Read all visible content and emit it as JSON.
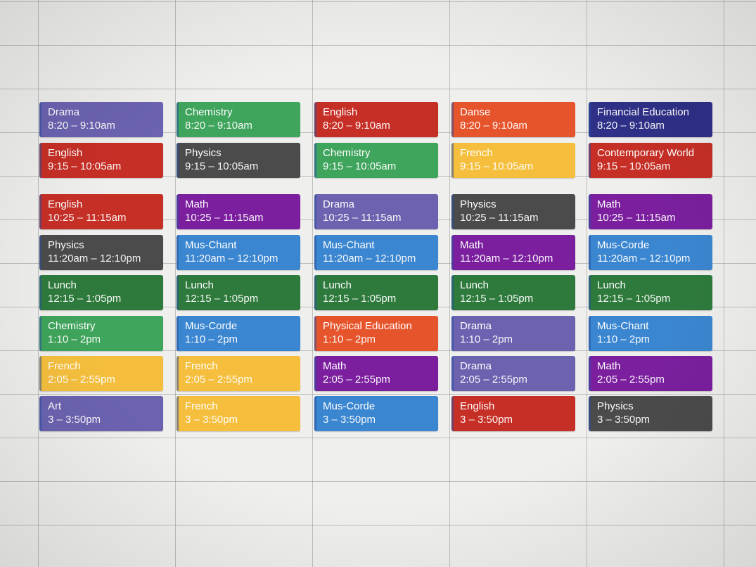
{
  "colors": {
    "lavender": "#6b63b0",
    "sage": "#3fa45c",
    "tomato": "#c62f26",
    "tangerine": "#e6542b",
    "blueberry": "#2f3088",
    "graphite": "#4c4b4b",
    "banana": "#f5bf3d",
    "grape": "#7b1f9e",
    "peacock": "#3b86d0",
    "basil": "#2e7a3c"
  },
  "days": [
    {
      "events": [
        {
          "title": "Drama",
          "time": "8:20 – 9:10am",
          "color": "#6b63b0"
        },
        {
          "title": "English",
          "time": "9:15 – 10:05am",
          "color": "#c62f26"
        },
        {
          "title": "English",
          "time": "10:25 – 11:15am",
          "color": "#c62f26"
        },
        {
          "title": "Physics",
          "time": "11:20am – 12:10pm",
          "color": "#4c4b4b"
        },
        {
          "title": "Lunch",
          "time": "12:15 – 1:05pm",
          "color": "#2e7a3c"
        },
        {
          "title": "Chemistry",
          "time": "1:10 – 2pm",
          "color": "#3fa45c"
        },
        {
          "title": "French",
          "time": "2:05 – 2:55pm",
          "color": "#f5bf3d"
        },
        {
          "title": "Art",
          "time": "3 – 3:50pm",
          "color": "#6b63b0"
        }
      ]
    },
    {
      "events": [
        {
          "title": "Chemistry",
          "time": "8:20 – 9:10am",
          "color": "#3fa45c"
        },
        {
          "title": "Physics",
          "time": "9:15 – 10:05am",
          "color": "#4c4b4b"
        },
        {
          "title": "Math",
          "time": "10:25 – 11:15am",
          "color": "#7b1f9e"
        },
        {
          "title": "Mus-Chant",
          "time": "11:20am – 12:10pm",
          "color": "#3b86d0"
        },
        {
          "title": "Lunch",
          "time": "12:15 – 1:05pm",
          "color": "#2e7a3c"
        },
        {
          "title": "Mus-Corde",
          "time": "1:10 – 2pm",
          "color": "#3b86d0"
        },
        {
          "title": "French",
          "time": "2:05 – 2:55pm",
          "color": "#f5bf3d"
        },
        {
          "title": "French",
          "time": "3 – 3:50pm",
          "color": "#f5bf3d"
        }
      ]
    },
    {
      "events": [
        {
          "title": "English",
          "time": "8:20 – 9:10am",
          "color": "#c62f26"
        },
        {
          "title": "Chemistry",
          "time": "9:15 – 10:05am",
          "color": "#3fa45c"
        },
        {
          "title": "Drama",
          "time": "10:25 – 11:15am",
          "color": "#6b63b0"
        },
        {
          "title": "Mus-Chant",
          "time": "11:20am – 12:10pm",
          "color": "#3b86d0"
        },
        {
          "title": "Lunch",
          "time": "12:15 – 1:05pm",
          "color": "#2e7a3c"
        },
        {
          "title": "Physical Education",
          "time": "1:10 – 2pm",
          "color": "#e6542b"
        },
        {
          "title": "Math",
          "time": "2:05 – 2:55pm",
          "color": "#7b1f9e"
        },
        {
          "title": "Mus-Corde",
          "time": "3 – 3:50pm",
          "color": "#3b86d0"
        }
      ]
    },
    {
      "events": [
        {
          "title": "Danse",
          "time": "8:20 – 9:10am",
          "color": "#e6542b"
        },
        {
          "title": "French",
          "time": "9:15 – 10:05am",
          "color": "#f5bf3d"
        },
        {
          "title": "Physics",
          "time": "10:25 – 11:15am",
          "color": "#4c4b4b"
        },
        {
          "title": "Math",
          "time": "11:20am – 12:10pm",
          "color": "#7b1f9e"
        },
        {
          "title": "Lunch",
          "time": "12:15 – 1:05pm",
          "color": "#2e7a3c"
        },
        {
          "title": "Drama",
          "time": "1:10 – 2pm",
          "color": "#6b63b0"
        },
        {
          "title": "Drama",
          "time": "2:05 – 2:55pm",
          "color": "#6b63b0"
        },
        {
          "title": "English",
          "time": "3 – 3:50pm",
          "color": "#c62f26"
        }
      ]
    },
    {
      "events": [
        {
          "title": "Financial Education",
          "time": "8:20 – 9:10am",
          "color": "#2f3088"
        },
        {
          "title": "Contemporary World",
          "time": "9:15 – 10:05am",
          "color": "#c62f26"
        },
        {
          "title": "Math",
          "time": "10:25 – 11:15am",
          "color": "#7b1f9e"
        },
        {
          "title": "Mus-Corde",
          "time": "11:20am – 12:10pm",
          "color": "#3b86d0"
        },
        {
          "title": "Lunch",
          "time": "12:15 – 1:05pm",
          "color": "#2e7a3c"
        },
        {
          "title": "Mus-Chant",
          "time": "1:10 – 2pm",
          "color": "#3b86d0"
        },
        {
          "title": "Math",
          "time": "2:05 – 2:55pm",
          "color": "#7b1f9e"
        },
        {
          "title": "Physics",
          "time": "3 – 3:50pm",
          "color": "#4c4b4b"
        }
      ]
    }
  ]
}
